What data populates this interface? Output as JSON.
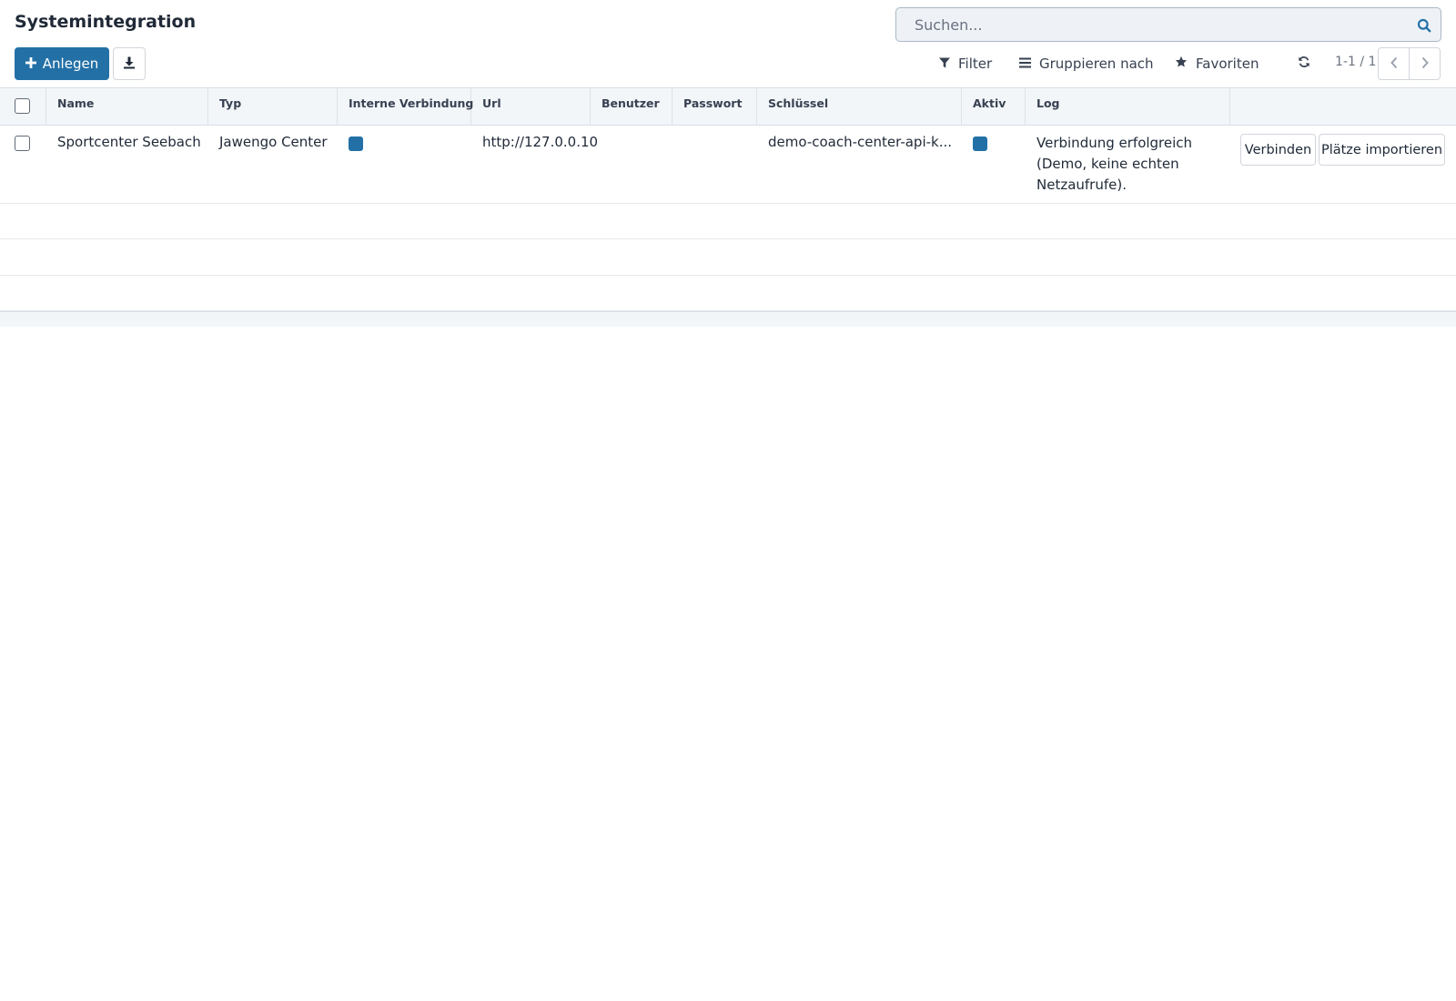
{
  "header": {
    "title": "Systemintegration"
  },
  "search": {
    "placeholder": "Suchen...",
    "icon": "search-icon"
  },
  "toolbar": {
    "create_label": "Anlegen",
    "create_icon": "plus-icon",
    "download_icon": "download-icon",
    "filter_label": "Filter",
    "group_label": "Gruppieren nach",
    "favorites_label": "Favoriten",
    "refresh_icon": "refresh-icon"
  },
  "pager": {
    "value": "1-1 / 1"
  },
  "colors": {
    "accent": "#2370a6",
    "header_bg": "#f3f6f9",
    "border": "#d8dee5"
  },
  "table": {
    "columns": {
      "name": "Name",
      "typ": "Typ",
      "internal": "Interne Verbindung",
      "url": "Url",
      "user": "Benutzer",
      "password": "Passwort",
      "key": "Schlüssel",
      "active": "Aktiv",
      "log": "Log"
    },
    "rows": [
      {
        "name": "Sportcenter Seebach",
        "typ": "Jawengo Center",
        "internal": true,
        "url": "http://127.0.0.10",
        "user": "",
        "password": "",
        "key": "demo-coach-center-api-k...",
        "active": true,
        "log": "Verbindung erfolgreich (Demo, keine echten Netzaufrufe).",
        "actions": {
          "connect": "Verbinden",
          "import": "Plätze importieren"
        }
      }
    ]
  }
}
